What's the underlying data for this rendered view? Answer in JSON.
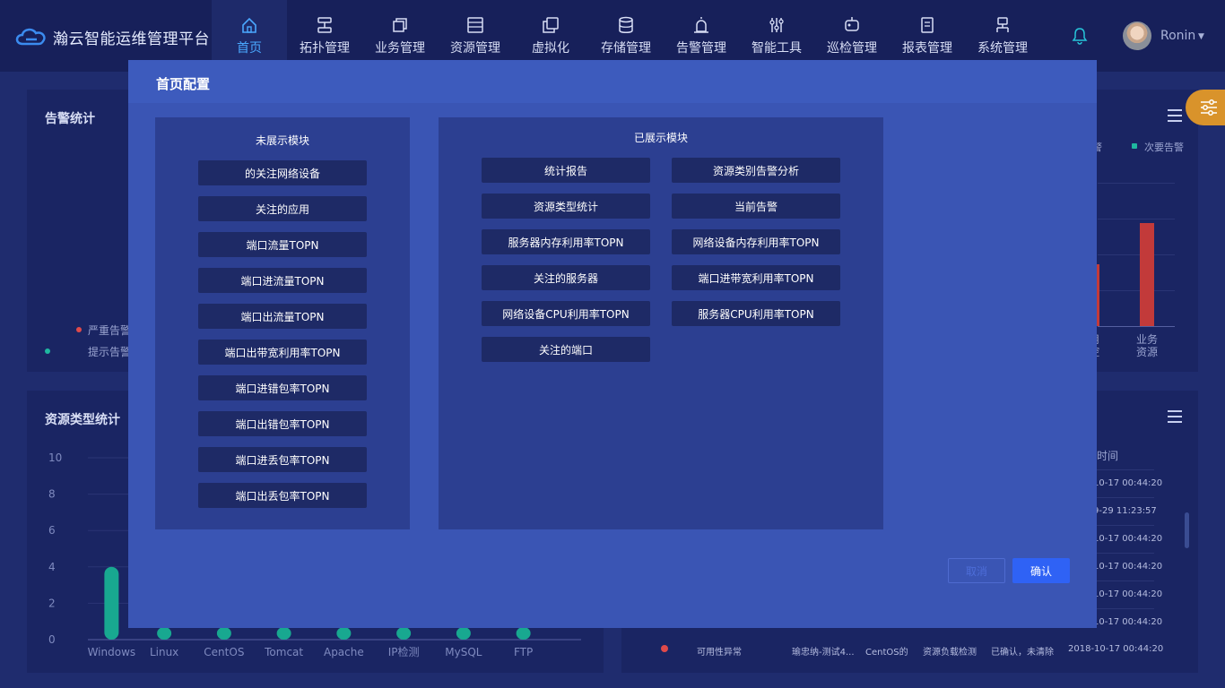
{
  "app": {
    "title": "瀚云智能运维管理平台"
  },
  "nav": [
    {
      "label": "首页",
      "icon": "home-icon",
      "active": true
    },
    {
      "label": "拓扑管理",
      "icon": "topology-icon"
    },
    {
      "label": "业务管理",
      "icon": "business-icon"
    },
    {
      "label": "资源管理",
      "icon": "resource-icon"
    },
    {
      "label": "虚拟化",
      "icon": "virtual-icon"
    },
    {
      "label": "存储管理",
      "icon": "storage-icon"
    },
    {
      "label": "告警管理",
      "icon": "alarm-icon"
    },
    {
      "label": "智能工具",
      "icon": "tools-icon"
    },
    {
      "label": "巡检管理",
      "icon": "inspect-icon"
    },
    {
      "label": "报表管理",
      "icon": "report-icon"
    },
    {
      "label": "系统管理",
      "icon": "system-icon"
    }
  ],
  "user": {
    "name": "Ronin"
  },
  "background": {
    "alarm_stats": {
      "title": "告警统计",
      "legend_serious": "严重告警",
      "legend_hint": "提示告警",
      "legend_secondary": "次要告警",
      "xlabel_partial_1": "用\n控",
      "xlabel_biz": "业务\n资源"
    },
    "resource_stats": {
      "title": "资源类型统计",
      "y_ticks": [
        "10",
        "8",
        "6",
        "4",
        "2",
        "0"
      ],
      "categories": [
        "Windows",
        "Linux",
        "CentOS",
        "Tomcat",
        "Apache",
        "IP检测",
        "MySQL",
        "FTP"
      ]
    },
    "alarm_table": {
      "col_time_partial": "时间",
      "times": [
        "10-17 00:44:20",
        "9-29 11:23:57",
        "10-17 00:44:20",
        "10-17 00:44:20",
        "10-17 00:44:20",
        "10-17 00:44:20"
      ],
      "last_row": [
        "可用性异常",
        "瑜忠纳-测试4...",
        "CentOS的",
        "资源负载检测",
        "已确认，未清除",
        "2018-10-17 00:44:20"
      ]
    }
  },
  "chart_data": {
    "type": "bar",
    "title": "资源类型统计",
    "categories": [
      "Windows",
      "Linux",
      "CentOS",
      "Tomcat",
      "Apache",
      "IP检测",
      "MySQL",
      "FTP"
    ],
    "values": [
      4,
      0.2,
      0.2,
      0.2,
      0.2,
      0.2,
      0.2,
      0.2
    ],
    "ylim": [
      0,
      10
    ],
    "y_ticks": [
      0,
      2,
      4,
      6,
      8,
      10
    ]
  },
  "modal": {
    "title": "首页配置",
    "hidden_title": "未展示模块",
    "shown_title": "已展示模块",
    "hidden_modules": [
      "的关注网络设备",
      "关注的应用",
      "端口流量TOPN",
      "端口进流量TOPN",
      "端口出流量TOPN",
      "端口出带宽利用率TOPN",
      "端口进错包率TOPN",
      "端口出错包率TOPN",
      "端口进丢包率TOPN",
      "端口出丢包率TOPN"
    ],
    "shown_modules": [
      "统计报告",
      "资源类别告警分析",
      "资源类型统计",
      "当前告警",
      "服务器内存利用率TOPN",
      "网络设备内存利用率TOPN",
      "关注的服务器",
      "端口进带宽利用率TOPN",
      "网络设备CPU利用率TOPN",
      "服务器CPU利用率TOPN",
      "关注的端口"
    ],
    "cancel_label": "取消",
    "confirm_label": "确认"
  },
  "colors": {
    "accent": "#2f62f5",
    "serious": "#e04a4a",
    "hint": "#1fb8a0",
    "bar_teal": "#18a890",
    "bar_red": "#c23a3a"
  }
}
